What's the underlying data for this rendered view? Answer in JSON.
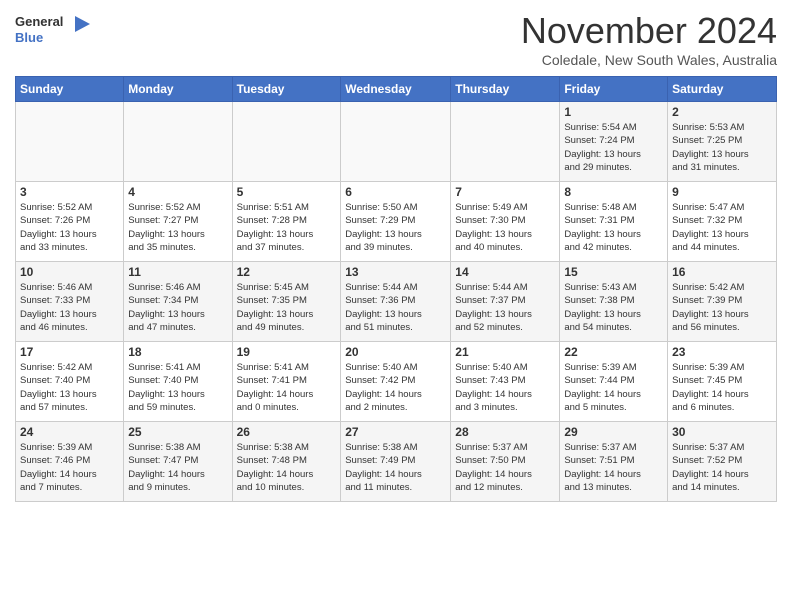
{
  "header": {
    "logo_general": "General",
    "logo_blue": "Blue",
    "month": "November 2024",
    "location": "Coledale, New South Wales, Australia"
  },
  "weekdays": [
    "Sunday",
    "Monday",
    "Tuesday",
    "Wednesday",
    "Thursday",
    "Friday",
    "Saturday"
  ],
  "weeks": [
    [
      {
        "day": "",
        "info": ""
      },
      {
        "day": "",
        "info": ""
      },
      {
        "day": "",
        "info": ""
      },
      {
        "day": "",
        "info": ""
      },
      {
        "day": "",
        "info": ""
      },
      {
        "day": "1",
        "info": "Sunrise: 5:54 AM\nSunset: 7:24 PM\nDaylight: 13 hours\nand 29 minutes."
      },
      {
        "day": "2",
        "info": "Sunrise: 5:53 AM\nSunset: 7:25 PM\nDaylight: 13 hours\nand 31 minutes."
      }
    ],
    [
      {
        "day": "3",
        "info": "Sunrise: 5:52 AM\nSunset: 7:26 PM\nDaylight: 13 hours\nand 33 minutes."
      },
      {
        "day": "4",
        "info": "Sunrise: 5:52 AM\nSunset: 7:27 PM\nDaylight: 13 hours\nand 35 minutes."
      },
      {
        "day": "5",
        "info": "Sunrise: 5:51 AM\nSunset: 7:28 PM\nDaylight: 13 hours\nand 37 minutes."
      },
      {
        "day": "6",
        "info": "Sunrise: 5:50 AM\nSunset: 7:29 PM\nDaylight: 13 hours\nand 39 minutes."
      },
      {
        "day": "7",
        "info": "Sunrise: 5:49 AM\nSunset: 7:30 PM\nDaylight: 13 hours\nand 40 minutes."
      },
      {
        "day": "8",
        "info": "Sunrise: 5:48 AM\nSunset: 7:31 PM\nDaylight: 13 hours\nand 42 minutes."
      },
      {
        "day": "9",
        "info": "Sunrise: 5:47 AM\nSunset: 7:32 PM\nDaylight: 13 hours\nand 44 minutes."
      }
    ],
    [
      {
        "day": "10",
        "info": "Sunrise: 5:46 AM\nSunset: 7:33 PM\nDaylight: 13 hours\nand 46 minutes."
      },
      {
        "day": "11",
        "info": "Sunrise: 5:46 AM\nSunset: 7:34 PM\nDaylight: 13 hours\nand 47 minutes."
      },
      {
        "day": "12",
        "info": "Sunrise: 5:45 AM\nSunset: 7:35 PM\nDaylight: 13 hours\nand 49 minutes."
      },
      {
        "day": "13",
        "info": "Sunrise: 5:44 AM\nSunset: 7:36 PM\nDaylight: 13 hours\nand 51 minutes."
      },
      {
        "day": "14",
        "info": "Sunrise: 5:44 AM\nSunset: 7:37 PM\nDaylight: 13 hours\nand 52 minutes."
      },
      {
        "day": "15",
        "info": "Sunrise: 5:43 AM\nSunset: 7:38 PM\nDaylight: 13 hours\nand 54 minutes."
      },
      {
        "day": "16",
        "info": "Sunrise: 5:42 AM\nSunset: 7:39 PM\nDaylight: 13 hours\nand 56 minutes."
      }
    ],
    [
      {
        "day": "17",
        "info": "Sunrise: 5:42 AM\nSunset: 7:40 PM\nDaylight: 13 hours\nand 57 minutes."
      },
      {
        "day": "18",
        "info": "Sunrise: 5:41 AM\nSunset: 7:40 PM\nDaylight: 13 hours\nand 59 minutes."
      },
      {
        "day": "19",
        "info": "Sunrise: 5:41 AM\nSunset: 7:41 PM\nDaylight: 14 hours\nand 0 minutes."
      },
      {
        "day": "20",
        "info": "Sunrise: 5:40 AM\nSunset: 7:42 PM\nDaylight: 14 hours\nand 2 minutes."
      },
      {
        "day": "21",
        "info": "Sunrise: 5:40 AM\nSunset: 7:43 PM\nDaylight: 14 hours\nand 3 minutes."
      },
      {
        "day": "22",
        "info": "Sunrise: 5:39 AM\nSunset: 7:44 PM\nDaylight: 14 hours\nand 5 minutes."
      },
      {
        "day": "23",
        "info": "Sunrise: 5:39 AM\nSunset: 7:45 PM\nDaylight: 14 hours\nand 6 minutes."
      }
    ],
    [
      {
        "day": "24",
        "info": "Sunrise: 5:39 AM\nSunset: 7:46 PM\nDaylight: 14 hours\nand 7 minutes."
      },
      {
        "day": "25",
        "info": "Sunrise: 5:38 AM\nSunset: 7:47 PM\nDaylight: 14 hours\nand 9 minutes."
      },
      {
        "day": "26",
        "info": "Sunrise: 5:38 AM\nSunset: 7:48 PM\nDaylight: 14 hours\nand 10 minutes."
      },
      {
        "day": "27",
        "info": "Sunrise: 5:38 AM\nSunset: 7:49 PM\nDaylight: 14 hours\nand 11 minutes."
      },
      {
        "day": "28",
        "info": "Sunrise: 5:37 AM\nSunset: 7:50 PM\nDaylight: 14 hours\nand 12 minutes."
      },
      {
        "day": "29",
        "info": "Sunrise: 5:37 AM\nSunset: 7:51 PM\nDaylight: 14 hours\nand 13 minutes."
      },
      {
        "day": "30",
        "info": "Sunrise: 5:37 AM\nSunset: 7:52 PM\nDaylight: 14 hours\nand 14 minutes."
      }
    ]
  ]
}
